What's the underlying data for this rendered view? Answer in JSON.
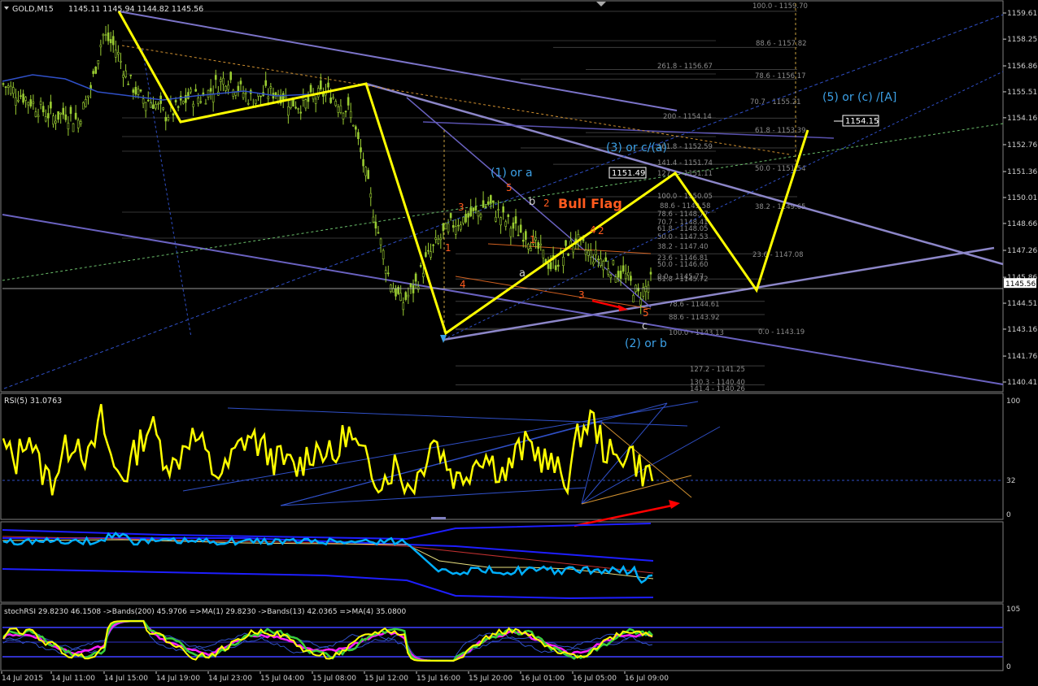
{
  "colors": {
    "background": "#000000",
    "grid": "#7f7f7f",
    "candle": "#9acd32",
    "wave": "#ffff00",
    "channel": "#7b73c8",
    "fib": "#4a4a4a",
    "fib_text": "#9a9a9a",
    "wave_label": "#3ca0e6",
    "count_label": "#ff5a1e",
    "rsi": "#ffff00",
    "red_arrow": "#ff0000"
  },
  "main": {
    "header": {
      "symbol": "GOLD,M15",
      "ohlc": "1145.11 1145.94 1144.82 1145.56"
    },
    "price_ticks": [
      "1159.61",
      "1158.25",
      "1156.86",
      "1155.51",
      "1154.16",
      "1152.76",
      "1151.36",
      "1150.01",
      "1148.66",
      "1147.26",
      "1145.86",
      "1144.51",
      "1143.16",
      "1141.76",
      "1140.41"
    ],
    "current_price": "1145.56",
    "price_boxes": [
      "1151.49",
      "1154.15"
    ],
    "annotations": {
      "bull_flag": "Bull Flag",
      "w1": "(1) or a",
      "w2": "(2) or b",
      "w3": "(3) or c/(a)",
      "w5": "(5) or (c) /[A]",
      "sub_a": "a",
      "sub_b": "b",
      "sub_c": "c"
    },
    "counts": [
      "1",
      "2",
      "3",
      "4",
      "5",
      "1",
      "2",
      "3",
      "4",
      "5"
    ],
    "fib_upper": [
      "100.0 - 1159.70",
      "88.6 - 1157.82",
      "261.8 - 1156.67",
      "78.6 - 1156.17",
      "70.7 - 1155.21",
      "200 - 1154.14",
      "61.8 - 1153.39",
      "161.8 - 1152.59",
      "141.4 - 1151.74",
      "50.0 - 1151.54",
      "127.2 - 1151.11",
      "100.0 - 1150.05",
      "88.6 - 1149.58",
      "38.2 - 1149.65",
      "78.6 - 1148.77",
      "70.7 - 1148.41",
      "61.8 - 1148.05",
      "23.6 - 1147.08",
      "50.0 - 1147.53",
      "38.2 - 1147.40",
      "23.6 - 1146.81",
      "50.0 - 1146.60",
      "0.0 - 1145.77",
      "61.8 - 1145.72",
      "78.6 - 1144.61",
      "88.6 - 1143.92",
      "100.0 - 1143.13",
      "0.0 - 1143.19"
    ],
    "fib_lower": [
      "127.2 - 1141.25",
      "130.3 - 1140.40",
      "141.4 - 1140.26"
    ]
  },
  "rsi_panel": {
    "title": "RSI(5) 31.0763",
    "ticks": [
      "100",
      "32",
      "0"
    ]
  },
  "bands_panel": {
    "title": ""
  },
  "stoch_panel": {
    "title": "stochRSI 29.8230 46.1508  ->Bands(200) 45.9706  =>MA(1) 29.8230  ->Bands(13) 42.0365  =>MA(4) 35.0800",
    "ticks": [
      "105",
      "0"
    ]
  },
  "time_axis": [
    "14 Jul 2015",
    "14 Jul 11:00",
    "14 Jul 15:00",
    "14 Jul 19:00",
    "14 Jul 23:00",
    "15 Jul 04:00",
    "15 Jul 08:00",
    "15 Jul 12:00",
    "15 Jul 16:00",
    "15 Jul 20:00",
    "16 Jul 01:00",
    "16 Jul 05:00",
    "16 Jul 09:00"
  ],
  "chart_data": {
    "type": "candlestick",
    "symbol": "GOLD",
    "timeframe": "M15",
    "last": {
      "open": 1145.11,
      "high": 1145.94,
      "low": 1144.82,
      "close": 1145.56
    },
    "ylim": [
      1139.9,
      1160.2
    ],
    "x_categories": [
      "14 Jul 2015",
      "14 Jul 11:00",
      "14 Jul 15:00",
      "14 Jul 19:00",
      "14 Jul 23:00",
      "15 Jul 04:00",
      "15 Jul 08:00",
      "15 Jul 12:00",
      "15 Jul 16:00",
      "15 Jul 20:00",
      "16 Jul 01:00",
      "16 Jul 05:00",
      "16 Jul 09:00"
    ],
    "close_path": [
      1155.9,
      1155.5,
      1155.1,
      1154.6,
      1154.2,
      1154.4,
      1154.0,
      1155.6,
      1158.5,
      1157.8,
      1156.2,
      1155.2,
      1155.0,
      1154.3,
      1154.6,
      1155.3,
      1155.2,
      1155.8,
      1156.3,
      1155.6,
      1155.1,
      1155.4,
      1155.5,
      1155.0,
      1154.8,
      1155.2,
      1155.5,
      1155.0,
      1154.3,
      1151.5,
      1148.5,
      1145.8,
      1144.5,
      1145.3,
      1146.8,
      1147.8,
      1148.6,
      1148.9,
      1149.2,
      1149.7,
      1149.0,
      1148.4,
      1148.1,
      1147.3,
      1146.4,
      1147.0,
      1147.8,
      1147.1,
      1146.8,
      1146.3,
      1145.9,
      1144.9,
      1145.6
    ],
    "rsi": {
      "period": 5,
      "value": 31.0763,
      "range": [
        0,
        100
      ],
      "level": 32
    },
    "stoch_rsi": {
      "value": 29.823,
      "bands200": 45.9706,
      "ma1": 29.823,
      "bands13": 42.0365,
      "ma4": 35.08,
      "range": [
        0,
        105
      ]
    },
    "fib_levels": [
      {
        "label": "100.0",
        "price": 1159.7
      },
      {
        "label": "88.6",
        "price": 1157.82
      },
      {
        "label": "261.8",
        "price": 1156.67
      },
      {
        "label": "78.6",
        "price": 1156.17
      },
      {
        "label": "200",
        "price": 1154.14
      },
      {
        "label": "61.8",
        "price": 1153.39
      },
      {
        "label": "161.8",
        "price": 1152.59
      },
      {
        "label": "141.4",
        "price": 1151.74
      },
      {
        "label": "100.0",
        "price": 1150.05
      },
      {
        "label": "23.6",
        "price": 1147.08
      },
      {
        "label": "0.0",
        "price": 1145.77
      },
      {
        "label": "78.6",
        "price": 1144.61
      },
      {
        "label": "88.6",
        "price": 1143.92
      },
      {
        "label": "100.0",
        "price": 1143.13
      },
      {
        "label": "0.0",
        "price": 1143.19
      },
      {
        "label": "127.2",
        "price": 1141.25
      },
      {
        "label": "141.4",
        "price": 1140.26
      }
    ]
  }
}
